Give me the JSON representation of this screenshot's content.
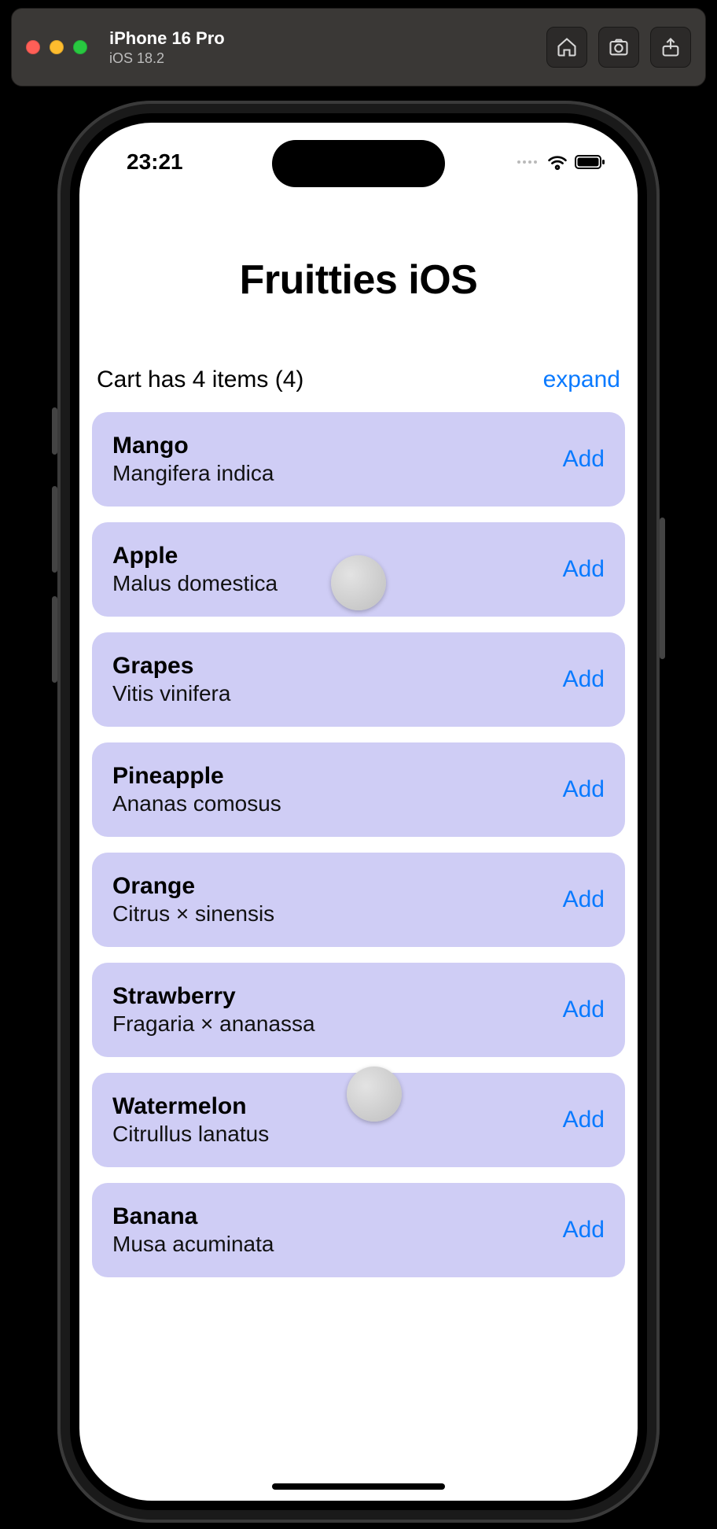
{
  "simulator": {
    "device": "iPhone 16 Pro",
    "os": "iOS 18.2"
  },
  "statusbar": {
    "time": "23:21"
  },
  "app": {
    "title": "Fruitties iOS",
    "cart_text": "Cart has 4 items (4)",
    "expand_label": "expand",
    "add_label": "Add",
    "items": [
      {
        "name": "Mango",
        "sub": "Mangifera indica"
      },
      {
        "name": "Apple",
        "sub": "Malus domestica"
      },
      {
        "name": "Grapes",
        "sub": "Vitis vinifera"
      },
      {
        "name": "Pineapple",
        "sub": "Ananas comosus"
      },
      {
        "name": "Orange",
        "sub": "Citrus × sinensis"
      },
      {
        "name": "Strawberry",
        "sub": "Fragaria × ananassa"
      },
      {
        "name": "Watermelon",
        "sub": "Citrullus lanatus"
      },
      {
        "name": "Banana",
        "sub": "Musa acuminata"
      }
    ]
  }
}
